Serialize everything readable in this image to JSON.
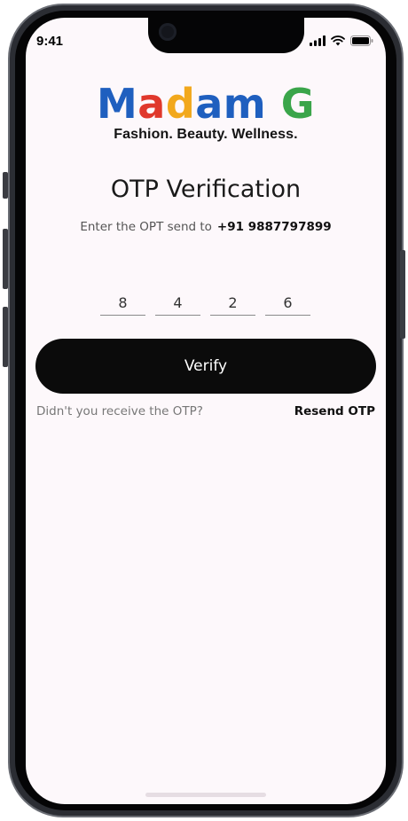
{
  "status_bar": {
    "time": "9:41",
    "icons": [
      "signal-icon",
      "wifi-icon",
      "battery-icon"
    ]
  },
  "brand": {
    "letters": [
      {
        "char": "M",
        "color": "#1f5fbf"
      },
      {
        "char": "a",
        "color": "#e0382c"
      },
      {
        "char": "d",
        "color": "#f2a81c"
      },
      {
        "char": "a",
        "color": "#1f5fbf"
      },
      {
        "char": "m",
        "color": "#1f5fbf"
      },
      {
        "char": " ",
        "color": "#000000"
      },
      {
        "char": "G",
        "color": "#3aa54a"
      }
    ],
    "tagline": "Fashion. Beauty. Wellness."
  },
  "otp": {
    "title": "OTP Verification",
    "subtitle_prefix": "Enter the OPT send to",
    "phone_number": "+91 9887797899",
    "digits": [
      "8",
      "4",
      "2",
      "6"
    ]
  },
  "actions": {
    "verify_label": "Verify",
    "resend_question": "Didn't you receive the OTP?",
    "resend_label": "Resend OTP"
  },
  "colors": {
    "screen_bg": "#fdf8fb",
    "button_bg": "#0b0b0b",
    "button_text": "#ffffff"
  }
}
